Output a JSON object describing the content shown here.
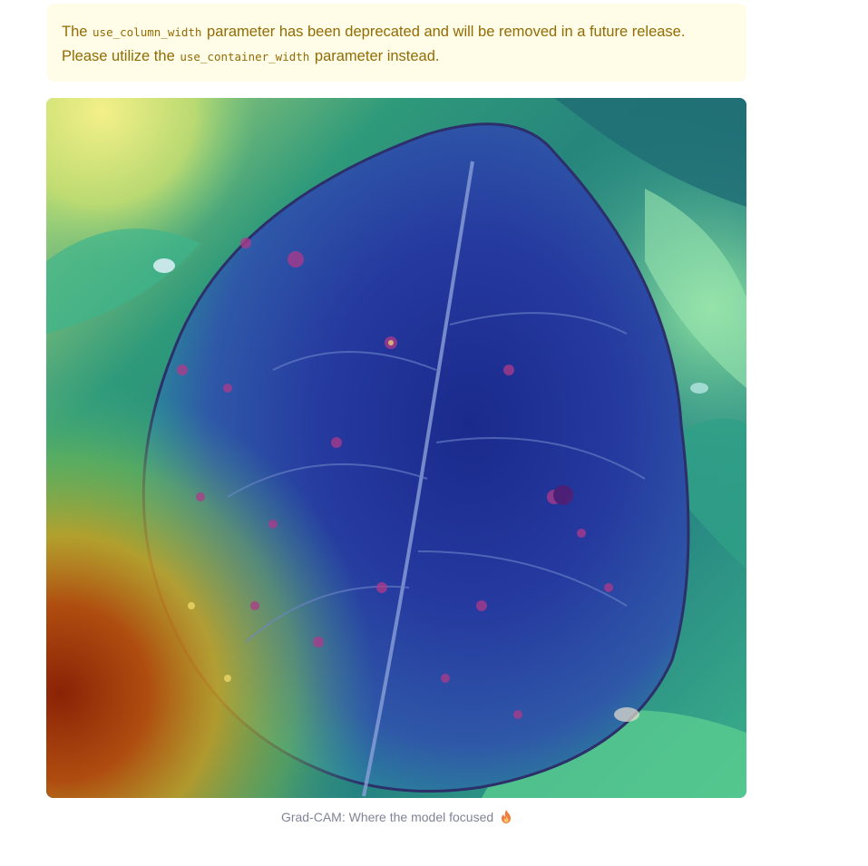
{
  "warning": {
    "text_before": "The ",
    "code_1": "use_column_width",
    "text_middle": " parameter has been deprecated and will be removed in a future release. Please utilize the ",
    "code_2": "use_container_width",
    "text_after": " parameter instead.",
    "background_color": "#fffce7",
    "text_color": "#926c05"
  },
  "image": {
    "alt": "Grad-CAM heatmap overlay on a leaf",
    "icon": "leaf-heatmap-image"
  },
  "caption": {
    "text": "Grad-CAM: Where the model focused",
    "icon": "fire-icon"
  }
}
